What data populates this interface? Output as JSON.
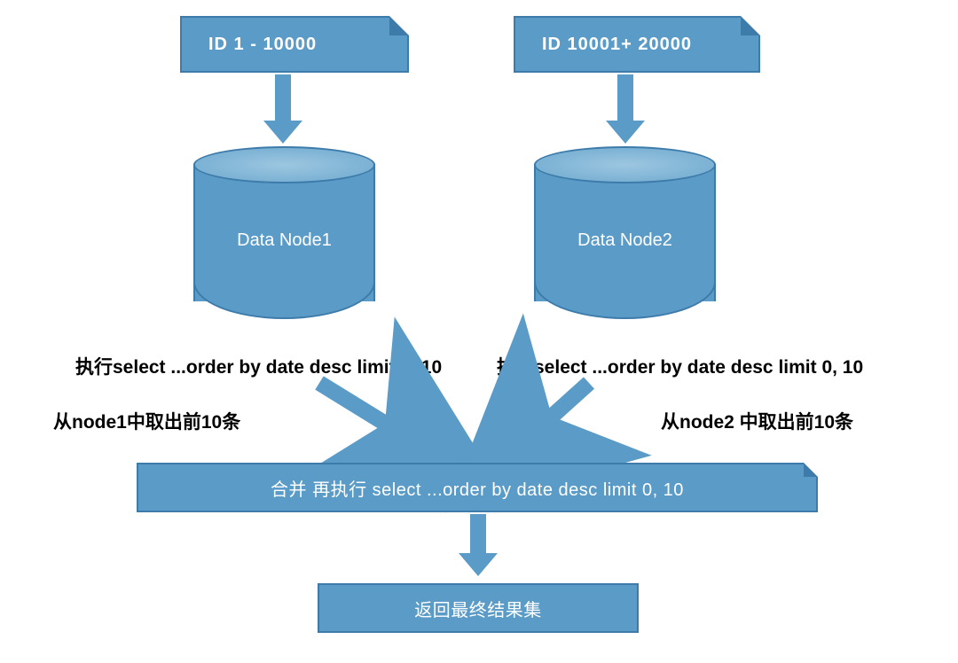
{
  "colors": {
    "blue_fill": "#5b9bc7",
    "blue_border": "#3d7bab",
    "blue_light": "#9cc6e0"
  },
  "id_box": {
    "left": "ID  1 - 10000",
    "right": "ID  10001+ 20000"
  },
  "cylinder": {
    "left": "Data Node1",
    "right": "Data Node2"
  },
  "captions": {
    "exec_left": "执行select ...order by date desc limit 0, 10",
    "exec_right": "执行select ...order by date desc limit 0, 10",
    "take_left": "从node1中取出前10条",
    "take_right": "从node2 中取出前10条"
  },
  "merge_bar": "合并  再执行 select ...order by date desc limit 0, 10",
  "result_bar": "返回最终结果集"
}
